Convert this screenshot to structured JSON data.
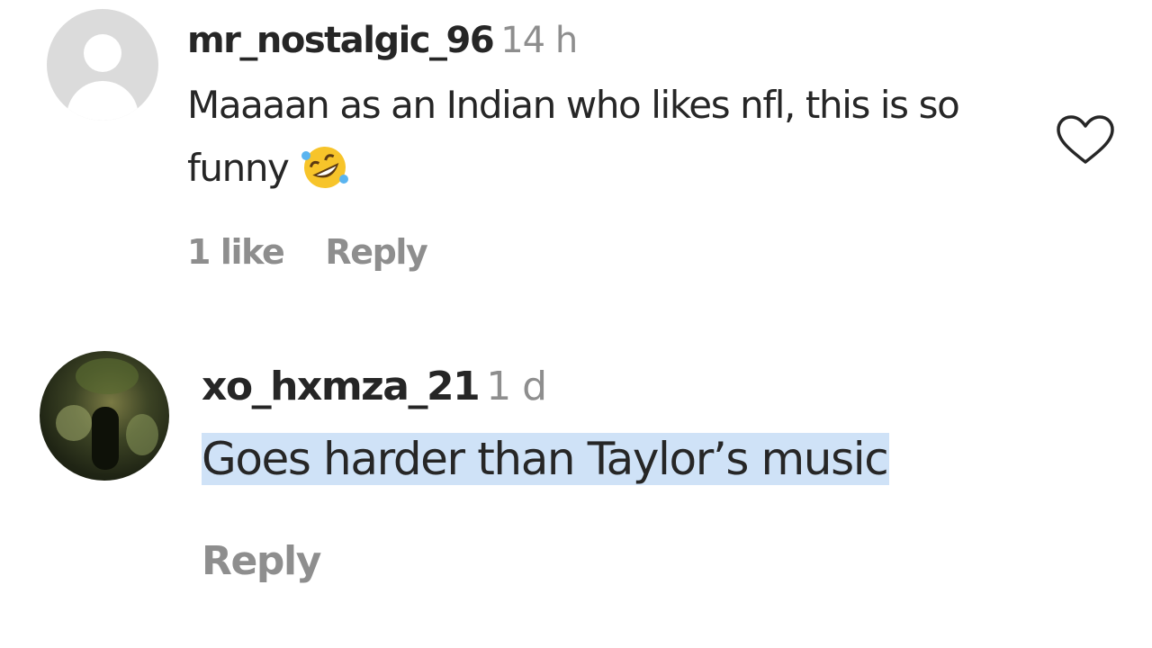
{
  "comments": [
    {
      "username": "mr_nostalgic_96",
      "time": "14 h",
      "text": "Maaaan as an Indian who likes nfl, this is so funny",
      "emoji": "rolling-on-floor-laughing",
      "likes_label": "1 like",
      "reply_label": "Reply",
      "avatar": "default-avatar-icon"
    },
    {
      "username": "xo_hxmza_21",
      "time": "1 d",
      "text": "Goes harder than Taylor’s music",
      "highlighted": true,
      "reply_label": "Reply",
      "avatar": "profile-photo"
    }
  ],
  "colors": {
    "text": "#262626",
    "secondary": "#8e8e8e",
    "highlight": "#cfe2f7"
  }
}
